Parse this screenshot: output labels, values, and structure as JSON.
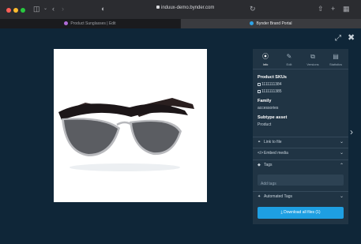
{
  "browser": {
    "url": "induux-demo.bynder.com",
    "tabs": [
      {
        "title": "Product Sunglasses | Edit"
      },
      {
        "title": "Bynder Brand Portal"
      }
    ]
  },
  "icons": {
    "sidebar": "sidebar-icon",
    "back": "chevron-left-icon",
    "forward": "chevron-right-icon",
    "privacy": "shield-icon",
    "reload": "reload-icon",
    "share": "share-icon",
    "new_tab": "plus-icon",
    "tab_overview": "grid-icon",
    "expand": "expand-icon",
    "close": "close-icon",
    "next": "chevron-right-icon",
    "info": "info-icon",
    "edit": "edit-icon",
    "versions": "versions-icon",
    "statistics": "statistics-icon",
    "link": "link-icon",
    "embed": "embed-icon",
    "tag": "tag-icon",
    "automated_tags": "wand-icon",
    "download": "download-icon"
  },
  "panel": {
    "tabs": [
      {
        "label": "Info"
      },
      {
        "label": "Edit"
      },
      {
        "label": "Versions"
      },
      {
        "label": "Statistics"
      }
    ],
    "product_skus_label": "Product SKUs",
    "skus": [
      "1111111384",
      "1111111385"
    ],
    "family_label": "Family",
    "family_value": "accessories",
    "subtype_label": "Subtype asset",
    "subtype_value": "Product",
    "link_to_file": "Link to file",
    "embed_media": "Embed media",
    "tags": "Tags",
    "tags_placeholder": "Add tags",
    "automated_tags": "Automated Tags",
    "download_all": "Download all files (1)"
  },
  "colors": {
    "page_bg": "#0f2638",
    "panel_bg": "#203444",
    "accent": "#1e9fe2"
  }
}
